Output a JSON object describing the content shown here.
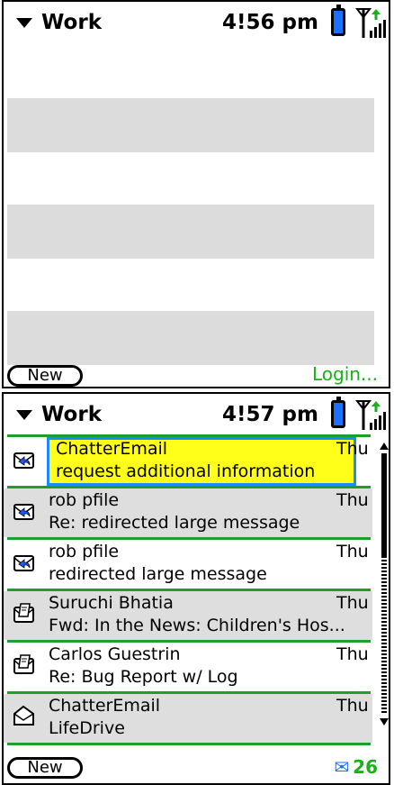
{
  "screen_top": {
    "category": "Work",
    "time": "4!56 pm",
    "new_button": "New",
    "login_link": "Login..."
  },
  "screen_bottom": {
    "category": "Work",
    "time": "4!57 pm",
    "new_button": "New",
    "unread_count": "26",
    "messages": [
      {
        "sender": "ChatterEmail",
        "date": "Thu",
        "subject": "request additional information",
        "icon": "reply-envelope-icon",
        "selected": true
      },
      {
        "sender": "rob pfile",
        "date": "Thu",
        "subject": "Re: redirected large message",
        "icon": "reply-envelope-icon"
      },
      {
        "sender": "rob pfile",
        "date": "Thu",
        "subject": "redirected large message",
        "icon": "reply-envelope-icon"
      },
      {
        "sender": "Suruchi Bhatia",
        "date": "Thu",
        "subject": "Fwd: In the News: Children's Hos...",
        "icon": "draft-envelope-icon"
      },
      {
        "sender": "Carlos Guestrin",
        "date": "Thu",
        "subject": "Re: Bug Report w/ Log",
        "icon": "draft-envelope-icon"
      },
      {
        "sender": "ChatterEmail",
        "date": "Thu",
        "subject": "LifeDrive",
        "icon": "open-envelope-icon"
      }
    ]
  },
  "colors": {
    "accent_green": "#16b316",
    "selection_yellow": "#ffff1a",
    "selection_border": "#1a8cff",
    "separator_green": "#1e9e2a",
    "battery_blue": "#1d6fff"
  }
}
